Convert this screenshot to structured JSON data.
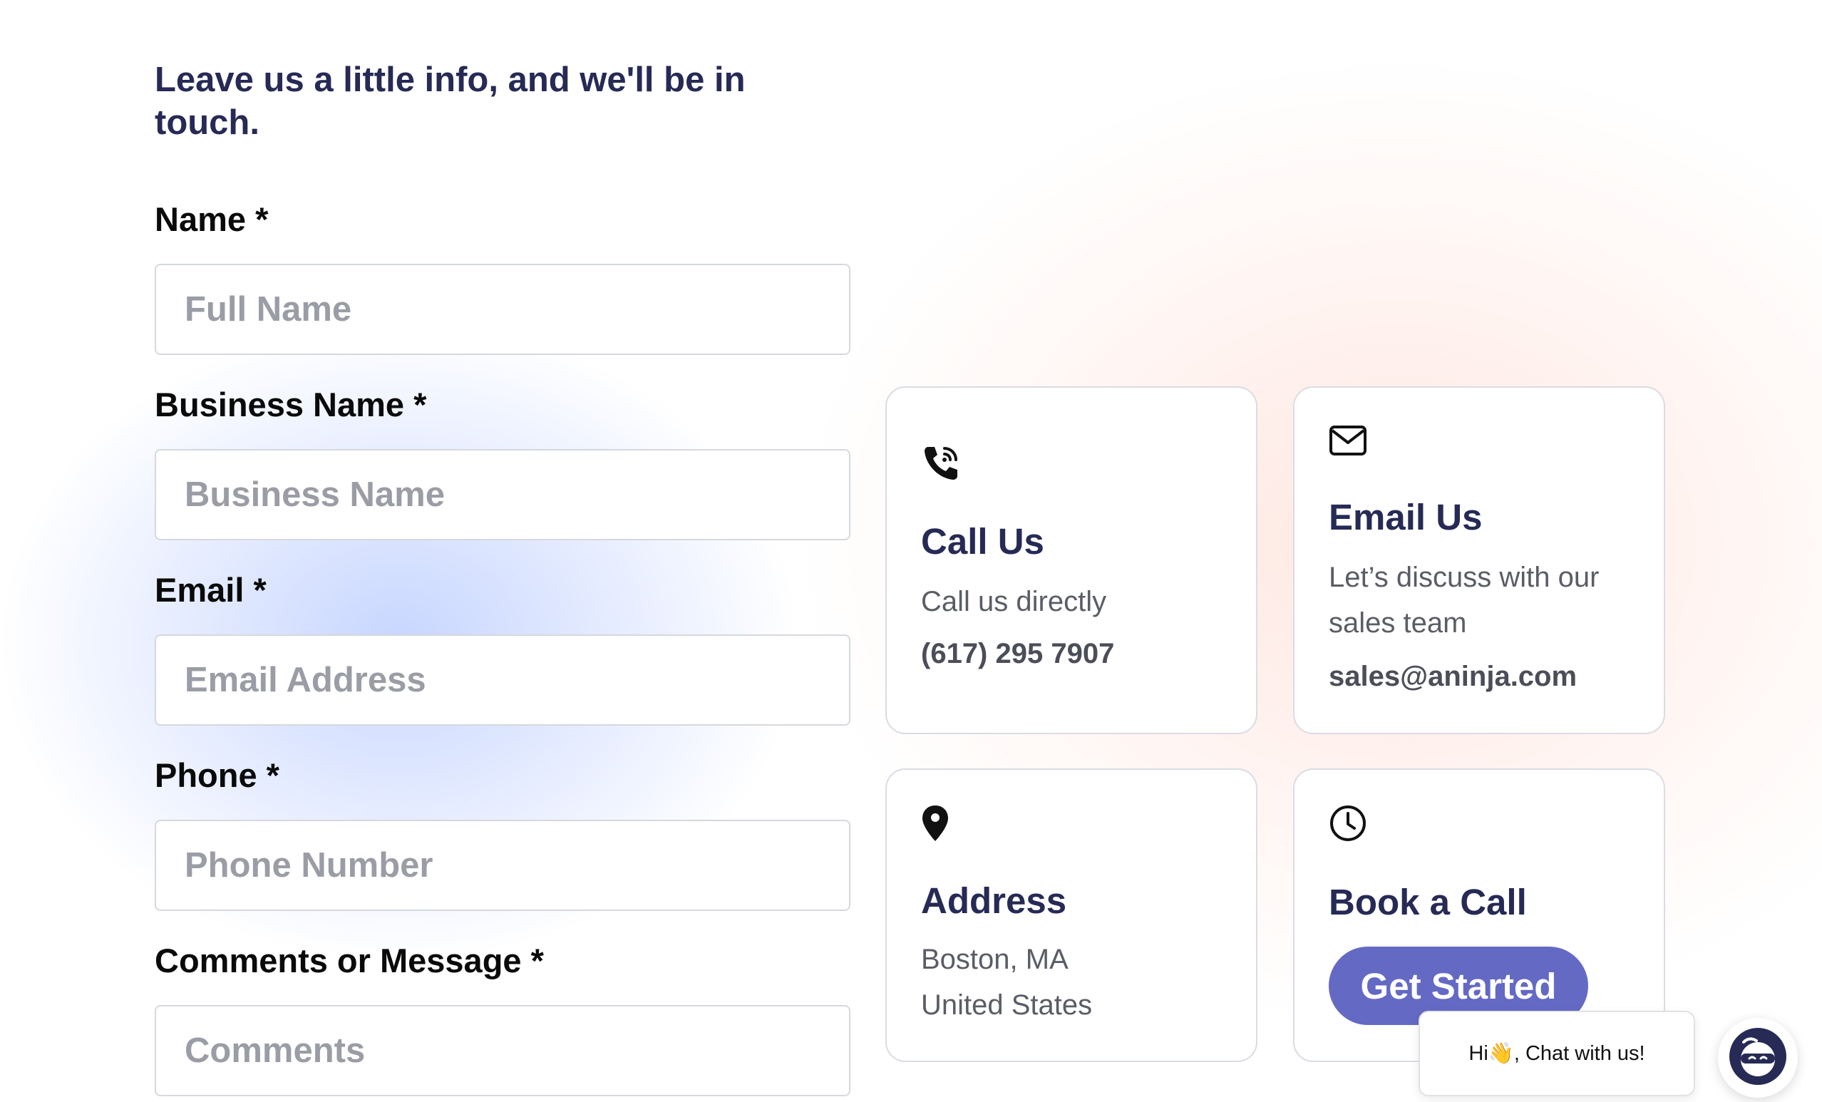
{
  "form": {
    "heading": "Leave us a little info, and we'll be in touch.",
    "fields": [
      {
        "label": "Name *",
        "placeholder": "Full Name"
      },
      {
        "label": "Business Name *",
        "placeholder": "Business Name"
      },
      {
        "label": "Email *",
        "placeholder": "Email Address"
      },
      {
        "label": "Phone *",
        "placeholder": "Phone Number"
      },
      {
        "label": "Comments or Message *",
        "placeholder": "Comments"
      }
    ]
  },
  "cards": {
    "call": {
      "icon": "phone-icon",
      "title": "Call Us",
      "subtitle": "Call us directly",
      "phone": "(617) 295 7907"
    },
    "email": {
      "icon": "envelope-icon",
      "title": "Email Us",
      "subtitle": "Let’s discuss with our sales team",
      "email": "sales@aninja.com"
    },
    "address": {
      "icon": "map-pin-icon",
      "title": "Address",
      "line1": "Boston, MA",
      "line2": "United States"
    },
    "book": {
      "icon": "clock-icon",
      "title": "Book a Call",
      "button_label": "Get Started"
    }
  },
  "chat": {
    "bubble_text": "Hi👋, Chat with us!",
    "launcher_icon": "ninja-avatar-icon"
  },
  "colors": {
    "heading": "#262a55",
    "accent": "#6469c4",
    "card_border": "#dadce3",
    "muted_text": "#5a5d66"
  }
}
